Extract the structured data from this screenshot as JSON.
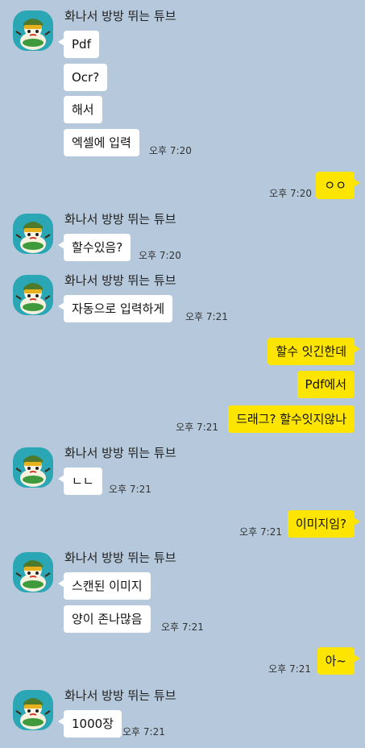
{
  "chat": {
    "groups": [
      {
        "sender": "화나서 방방 뛰는 튜브",
        "messages": [
          "Pdf",
          "Ocr?",
          "해서",
          "엑셀에 입력"
        ],
        "time": "오후 7:20"
      },
      {
        "outgoing": true,
        "messages": [
          "ㅇㅇ"
        ],
        "time": "오후 7:20"
      },
      {
        "sender": "화나서 방방 뛰는 튜브",
        "messages": [
          "할수있음?"
        ],
        "time": "오후 7:20"
      },
      {
        "sender": "화나서 방방 뛰는 튜브",
        "messages": [
          "자동으로 입력하게"
        ],
        "time": "오후 7:21"
      },
      {
        "outgoing": true,
        "messages": [
          "할수 잇긴한데",
          "Pdf에서",
          "드래그? 할수잇지않나"
        ],
        "time": "오후 7:21"
      },
      {
        "sender": "화나서 방방 뛰는 튜브",
        "messages": [
          "ㄴㄴ"
        ],
        "time": "오후 7:21"
      },
      {
        "outgoing": true,
        "messages": [
          "이미지임?"
        ],
        "time": "오후 7:21"
      },
      {
        "sender": "화나서 방방 뛰는 튜브",
        "messages": [
          "스캔된 이미지",
          "양이 존나많음"
        ],
        "time": "오후 7:21"
      },
      {
        "outgoing": true,
        "messages": [
          "아~"
        ],
        "time": "오후 7:21"
      },
      {
        "sender": "화나서 방방 뛰는 튜브",
        "messages": [
          "1000장"
        ],
        "time": "오후 7:21"
      }
    ]
  },
  "avatar_icon": "tube-character-icon",
  "colors": {
    "background": "#b6c9dc",
    "incoming_bubble": "#ffffff",
    "outgoing_bubble": "#fee500",
    "avatar_bg": "#2aa6b4"
  }
}
